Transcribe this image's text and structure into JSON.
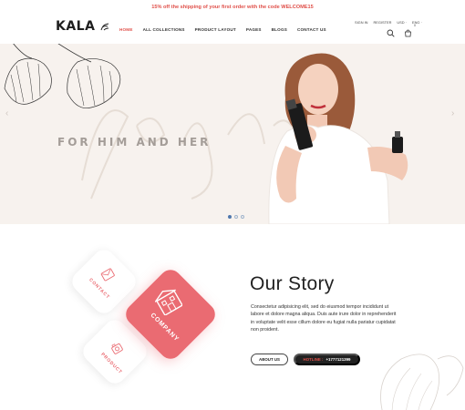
{
  "announcement": "15% off the shipping of your first order with the code WELCOME15",
  "header": {
    "logo": "KALA",
    "nav": [
      "HOME",
      "ALL COLLECTIONS",
      "PRODUCT LAYOUT",
      "PAGES",
      "BLOGS",
      "CONTACT US"
    ],
    "active_nav": "HOME",
    "top_links": [
      "SIGN IN",
      "REGISTER",
      "USD ·",
      "ENG ·"
    ],
    "cart_count": "0"
  },
  "hero": {
    "headline": "FOR HIM AND HER",
    "slide_count": 3,
    "active_slide": 1
  },
  "story": {
    "title": "Our Story",
    "body": "Consectetur adipisicing elit, sed do eiusmod tempor incididunt ut labore et dolore magna aliqua. Duis aute irure dolor in reprehenderit in voluptate velit esse cillum dolore eu fugiat nulla pariatur cupidatat non proident.",
    "cards": {
      "contact": "CONTACT",
      "company": "COMPANY",
      "product": "PRODUCT"
    },
    "about_button": "ABOUT US",
    "hotline_label": "HOTLINE :",
    "hotline_number": "+1777121399"
  },
  "colors": {
    "accent": "#e0504a",
    "card_red": "#ea6b72",
    "hero_bg": "#f7f2ee",
    "dark_button": "#222222"
  }
}
